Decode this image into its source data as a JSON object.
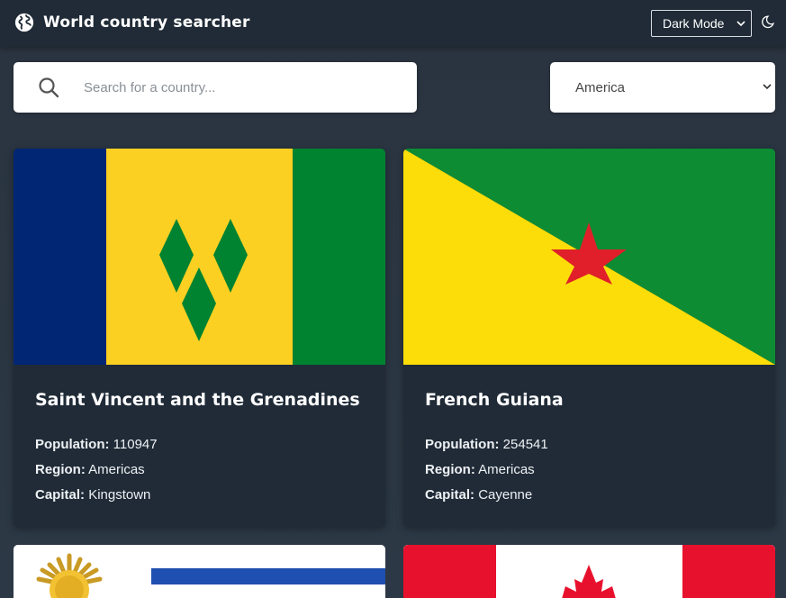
{
  "header": {
    "title": "World country searcher",
    "theme_select_value": "Dark Mode",
    "globe_icon": "globe-icon",
    "theme_icon": "moon-icon"
  },
  "search": {
    "placeholder": "Search for a country...",
    "value": ""
  },
  "filter": {
    "selected": "America"
  },
  "labels": {
    "population": "Population:",
    "region": "Region:",
    "capital": "Capital:"
  },
  "countries": [
    {
      "name": "Saint Vincent and the Grenadines",
      "population": "110947",
      "region": "Americas",
      "capital": "Kingstown",
      "flag": "saint-vincent-flag"
    },
    {
      "name": "French Guiana",
      "population": "254541",
      "region": "Americas",
      "capital": "Cayenne",
      "flag": "french-guiana-flag"
    },
    {
      "flag": "uruguay-flag"
    },
    {
      "flag": "canada-flag"
    }
  ],
  "colors": {
    "background": "#2b3743",
    "surface": "#202b37",
    "text": "#ffffff"
  }
}
